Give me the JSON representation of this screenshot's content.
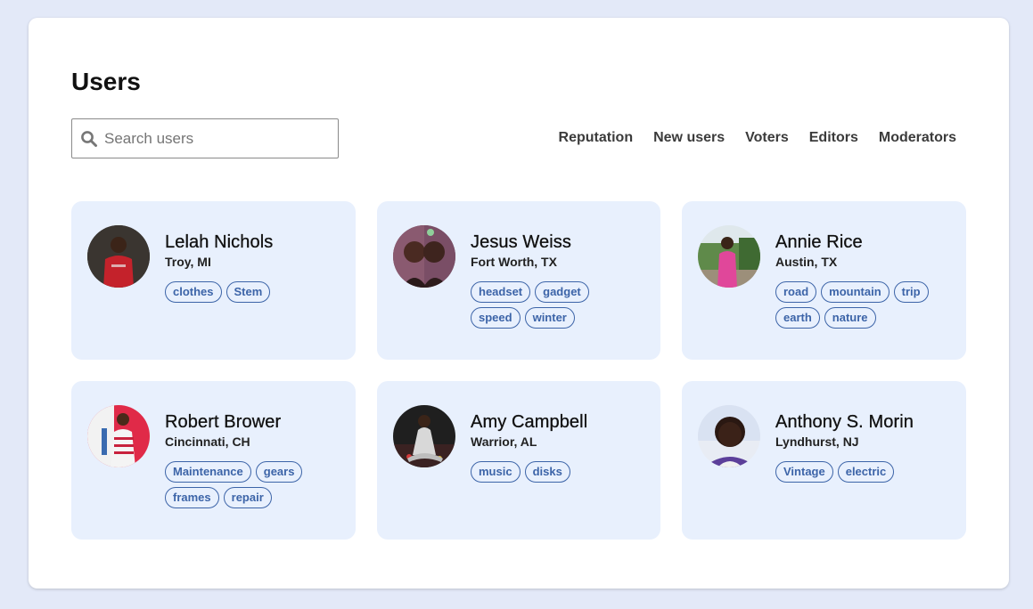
{
  "page": {
    "title": "Users"
  },
  "search": {
    "placeholder": "Search users",
    "icon": "search-icon"
  },
  "tabs": [
    {
      "label": "Reputation"
    },
    {
      "label": "New users"
    },
    {
      "label": "Voters"
    },
    {
      "label": "Editors"
    },
    {
      "label": "Moderators"
    }
  ],
  "users": [
    {
      "name": "Lelah Nichols",
      "location": "Troy, MI",
      "tags": [
        "clothes",
        "Stem"
      ],
      "avatar": "avatar-photo"
    },
    {
      "name": "Jesus Weiss",
      "location": "Fort Worth, TX",
      "tags": [
        "headset",
        "gadget",
        "speed",
        "winter"
      ],
      "avatar": "avatar-photo"
    },
    {
      "name": "Annie Rice",
      "location": "Austin, TX",
      "tags": [
        "road",
        "mountain",
        "trip",
        "earth",
        "nature"
      ],
      "avatar": "avatar-photo"
    },
    {
      "name": "Robert Brower",
      "location": "Cincinnati, CH",
      "tags": [
        "Maintenance",
        "gears",
        "frames",
        "repair"
      ],
      "avatar": "avatar-photo"
    },
    {
      "name": "Amy Campbell",
      "location": "Warrior, AL",
      "tags": [
        "music",
        "disks"
      ],
      "avatar": "avatar-photo"
    },
    {
      "name": "Anthony S. Morin",
      "location": "Lyndhurst, NJ",
      "tags": [
        "Vintage",
        "electric"
      ],
      "avatar": "avatar-photo"
    }
  ],
  "colors": {
    "background": "#e3e9f8",
    "panel": "#ffffff",
    "card": "#e8f0fd",
    "tag": "#3c64a8"
  }
}
